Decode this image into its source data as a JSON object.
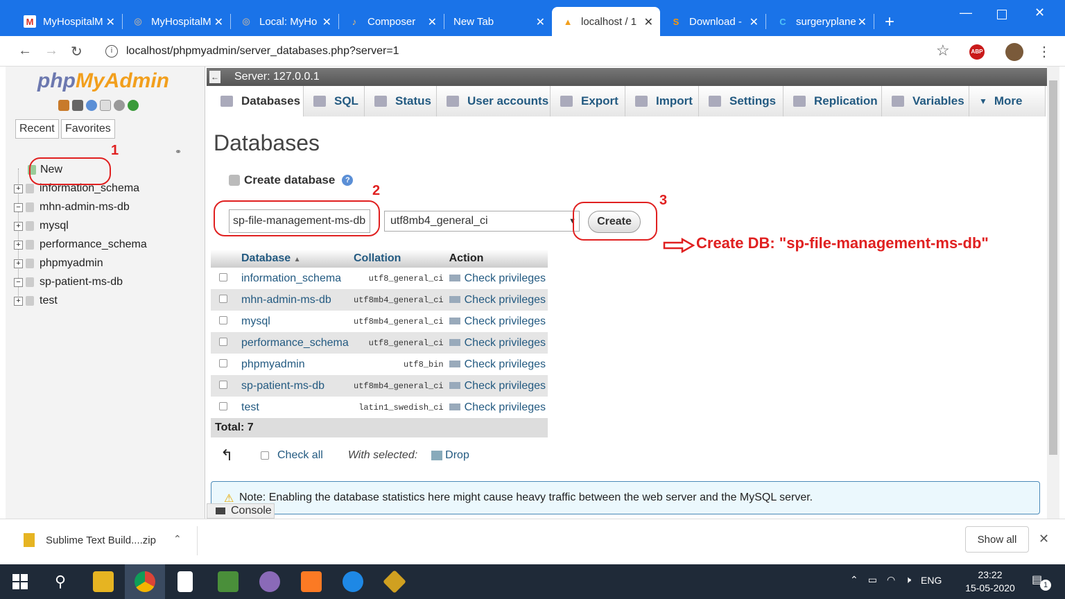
{
  "browser": {
    "tabs": [
      {
        "label": "MyHospitalM",
        "icon": "M",
        "color": "#d93025"
      },
      {
        "label": "MyHospitalM",
        "icon": "◎",
        "color": "#9aa6b5"
      },
      {
        "label": "Local: MyHo",
        "icon": "◎",
        "color": "#9aa6b5"
      },
      {
        "label": "Composer",
        "icon": "♪",
        "color": "#f0c070"
      },
      {
        "label": "New Tab",
        "icon": "",
        "color": "#ffffff"
      },
      {
        "label": "localhost / 1",
        "icon": "▲",
        "color": "#f29f1c"
      },
      {
        "label": "Download -",
        "icon": "S",
        "color": "#ff9800"
      },
      {
        "label": "surgeryplane",
        "icon": "C",
        "color": "#4fc3f7"
      }
    ],
    "url": "localhost/phpmyadmin/server_databases.php?server=1"
  },
  "nav": {
    "logo_php": "php",
    "logo_my": "MyAdmin",
    "recent": "Recent",
    "favorites": "Favorites",
    "new": "New",
    "databases": [
      "information_schema",
      "mhn-admin-ms-db",
      "mysql",
      "performance_schema",
      "phpmyadmin",
      "sp-patient-ms-db",
      "test"
    ]
  },
  "main": {
    "server": "Server: 127.0.0.1",
    "tabs": [
      "Databases",
      "SQL",
      "Status",
      "User accounts",
      "Export",
      "Import",
      "Settings",
      "Replication",
      "Variables",
      "More"
    ],
    "title": "Databases",
    "create_head": "Create database",
    "db_name_value": "sp-file-management-ms-db",
    "collation_value": "utf8mb4_general_ci",
    "create_label": "Create",
    "table": {
      "headers": {
        "database": "Database",
        "collation": "Collation",
        "action": "Action"
      },
      "rows": [
        {
          "name": "information_schema",
          "collation": "utf8_general_ci",
          "action": "Check privileges"
        },
        {
          "name": "mhn-admin-ms-db",
          "collation": "utf8mb4_general_ci",
          "action": "Check privileges"
        },
        {
          "name": "mysql",
          "collation": "utf8mb4_general_ci",
          "action": "Check privileges"
        },
        {
          "name": "performance_schema",
          "collation": "utf8_general_ci",
          "action": "Check privileges"
        },
        {
          "name": "phpmyadmin",
          "collation": "utf8_bin",
          "action": "Check privileges"
        },
        {
          "name": "sp-patient-ms-db",
          "collation": "utf8mb4_general_ci",
          "action": "Check privileges"
        },
        {
          "name": "test",
          "collation": "latin1_swedish_ci",
          "action": "Check privileges"
        }
      ],
      "total": "Total: 7"
    },
    "check_all": "Check all",
    "with_selected": "With selected:",
    "drop": "Drop",
    "note": "Note: Enabling the database statistics here might cause heavy traffic between the web server and the MySQL server.",
    "console": "Console"
  },
  "annotations": {
    "n1": "1",
    "n2": "2",
    "n3": "3",
    "text": "Create DB: \"sp-file-management-ms-db\"",
    "color": "#e02020"
  },
  "downloads": {
    "file": "Sublime Text Build....zip",
    "show_all": "Show all"
  },
  "taskbar": {
    "lang": "ENG",
    "time": "23:22",
    "date": "15-05-2020",
    "notifications": "1"
  }
}
